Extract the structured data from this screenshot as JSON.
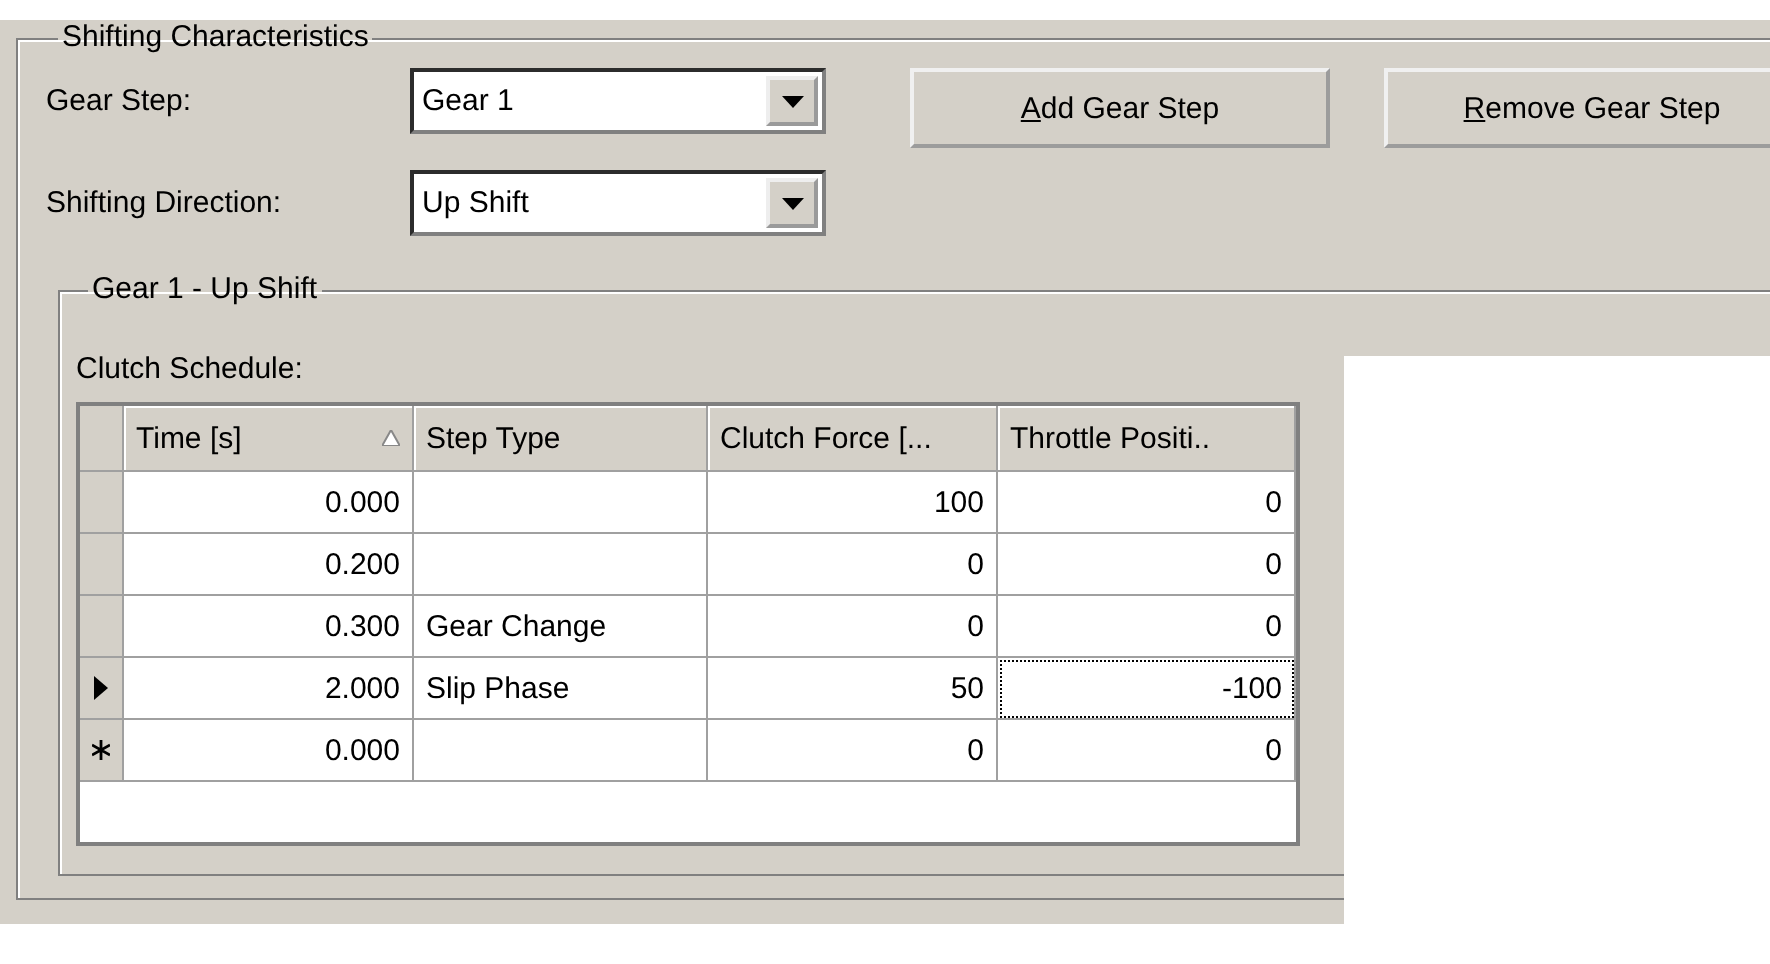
{
  "group": {
    "title": "Shifting Characteristics",
    "fields": [
      {
        "label": "Gear Step:",
        "value": "Gear 1"
      },
      {
        "label": "Shifting Direction:",
        "value": "Up Shift"
      }
    ],
    "buttons": [
      {
        "label": "Add Gear Step",
        "underline_first": true
      },
      {
        "label": "Remove Gear Step",
        "underline_first": true
      }
    ],
    "subgroup": {
      "title": "Gear 1 - Up Shift",
      "table_label": "Clutch Schedule:",
      "table": {
        "columns": [
          {
            "label": "Time [s]",
            "sorted": true
          },
          {
            "label": "Step Type",
            "sorted": false
          },
          {
            "label": "Clutch Force [...",
            "sorted": false
          },
          {
            "label": "Throttle Positi..",
            "sorted": false
          }
        ],
        "rows": [
          {
            "kind": "data",
            "cells": [
              {
                "text": "0.000",
                "focused": false
              },
              {
                "text": "",
                "focused": false
              },
              {
                "text": "100",
                "focused": false
              },
              {
                "text": "0",
                "focused": false
              }
            ]
          },
          {
            "kind": "data",
            "cells": [
              {
                "text": "0.200",
                "focused": false
              },
              {
                "text": "",
                "focused": false
              },
              {
                "text": "0",
                "focused": false
              },
              {
                "text": "0",
                "focused": false
              }
            ]
          },
          {
            "kind": "data",
            "cells": [
              {
                "text": "0.300",
                "focused": false
              },
              {
                "text": "Gear Change",
                "focused": false
              },
              {
                "text": "0",
                "focused": false
              },
              {
                "text": "0",
                "focused": false
              }
            ]
          },
          {
            "kind": "current",
            "cells": [
              {
                "text": "2.000",
                "focused": false
              },
              {
                "text": "Slip Phase",
                "focused": false
              },
              {
                "text": "50",
                "focused": false
              },
              {
                "text": "-100",
                "focused": true
              }
            ]
          },
          {
            "kind": "new",
            "cells": [
              {
                "text": "0.000",
                "focused": false
              },
              {
                "text": "",
                "focused": false
              },
              {
                "text": "0",
                "focused": false
              },
              {
                "text": "0",
                "focused": false
              }
            ]
          }
        ]
      }
    }
  }
}
